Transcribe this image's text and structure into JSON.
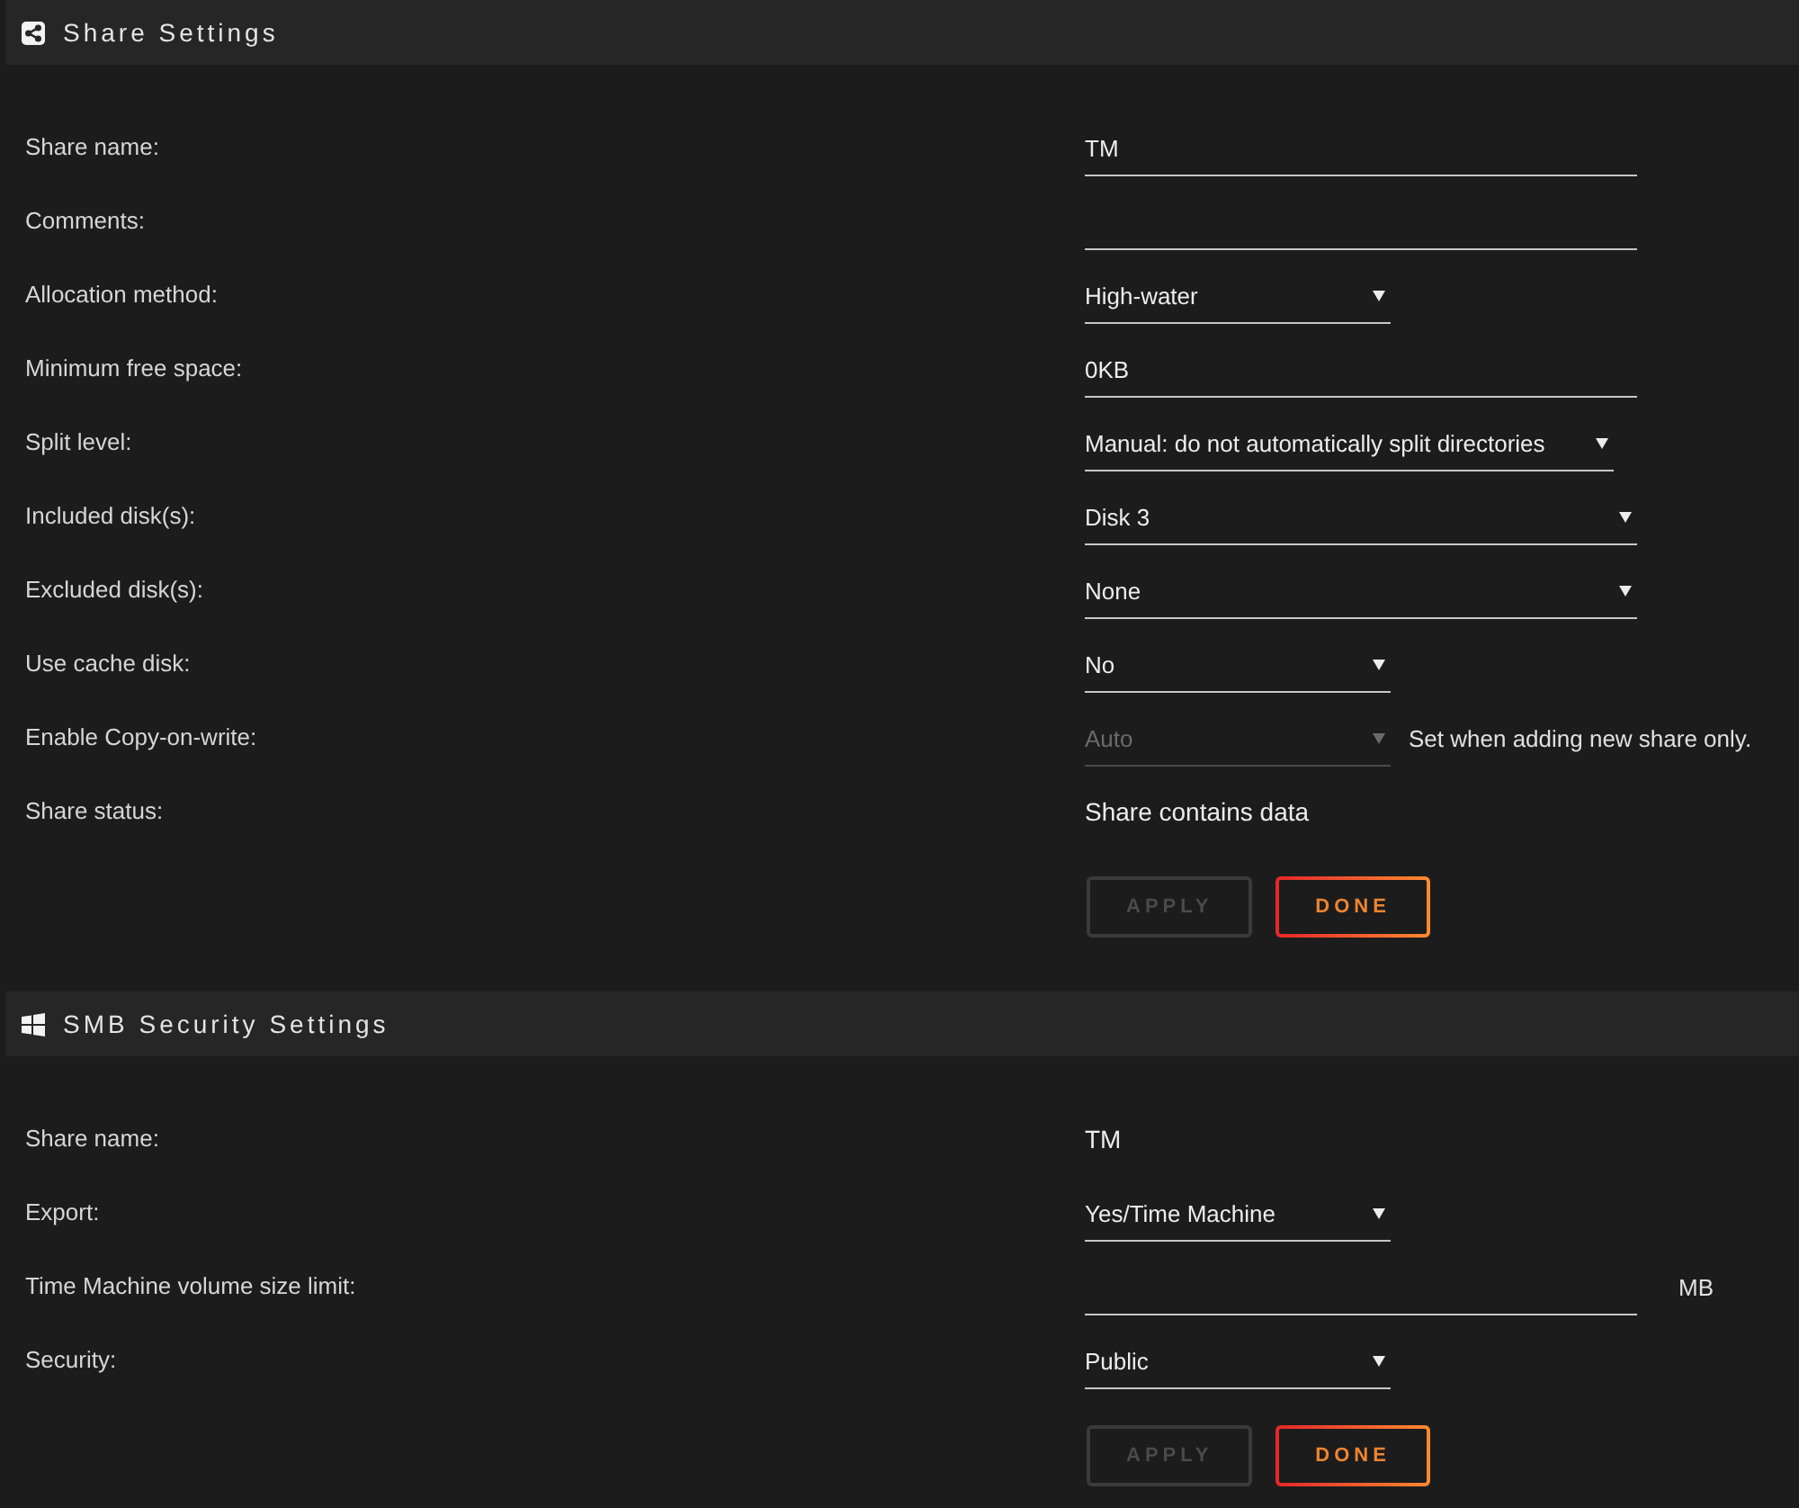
{
  "sections": [
    {
      "kind": "share",
      "title": "Share Settings",
      "fields": [
        {
          "label": "Share name:",
          "kind": "input",
          "value": "TM",
          "disabled": false
        },
        {
          "label": "Comments:",
          "kind": "input",
          "disabled": false
        },
        {
          "label": "Allocation method:",
          "kind": "select",
          "value": "High-water",
          "disabled": false
        },
        {
          "label": "Minimum free space:",
          "kind": "input",
          "value": "0KB",
          "disabled": false
        },
        {
          "label": "Split level:",
          "kind": "select",
          "value": "Manual: do not automatically split directories",
          "disabled": false
        },
        {
          "label": "Included disk(s):",
          "kind": "multiselect",
          "value": "Disk 3",
          "disabled": false
        },
        {
          "label": "Excluded disk(s):",
          "kind": "multiselect",
          "value": "None",
          "disabled": false
        },
        {
          "label": "Use cache disk:",
          "kind": "select",
          "value": "No",
          "disabled": false
        },
        {
          "label": "Enable Copy-on-write:",
          "kind": "select",
          "value": "Auto",
          "disabled": true,
          "note": "Set when adding new share only."
        },
        {
          "label": "Share status:",
          "kind": "static",
          "value": "Share contains data",
          "disabled": false
        }
      ],
      "buttons": [
        {
          "label": "APPLY",
          "disabled": true
        },
        {
          "label": "DONE",
          "disabled": false
        }
      ]
    },
    {
      "kind": "smb",
      "title": "SMB Security Settings",
      "fields": [
        {
          "label": "Share name:",
          "kind": "static",
          "value": "TM",
          "disabled": false
        },
        {
          "label": "Export:",
          "kind": "select",
          "value": "Yes/Time Machine",
          "disabled": false
        },
        {
          "label": "Time Machine volume size limit:",
          "kind": "input",
          "unit": "MB",
          "disabled": false
        },
        {
          "label": "Security:",
          "kind": "select",
          "value": "Public",
          "disabled": false
        }
      ],
      "buttons": [
        {
          "label": "APPLY",
          "disabled": true
        },
        {
          "label": "DONE",
          "disabled": false
        }
      ]
    }
  ]
}
